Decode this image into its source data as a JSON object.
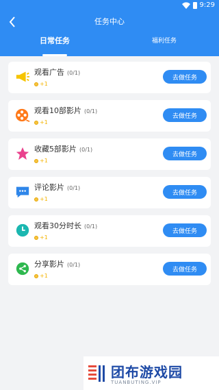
{
  "status": {
    "time": "9:29"
  },
  "header": {
    "title": "任务中心"
  },
  "tabs": [
    {
      "label": "日常任务",
      "active": true
    },
    {
      "label": "福利任务",
      "active": false
    }
  ],
  "tasks": [
    {
      "name": "观看广告",
      "progress": "(0/1)",
      "reward": "+1",
      "action": "去做任务",
      "icon": "megaphone-icon"
    },
    {
      "name": "观看10部影片",
      "progress": "(0/1)",
      "reward": "+1",
      "action": "去做任务",
      "icon": "film-reel-icon"
    },
    {
      "name": "收藏5部影片",
      "progress": "(0/1)",
      "reward": "+1",
      "action": "去做任务",
      "icon": "star-icon"
    },
    {
      "name": "评论影片",
      "progress": "(0/1)",
      "reward": "+1",
      "action": "去做任务",
      "icon": "comment-icon"
    },
    {
      "name": "观看30分时长",
      "progress": "(0/1)",
      "reward": "+1",
      "action": "去做任务",
      "icon": "clock-icon"
    },
    {
      "name": "分享影片",
      "progress": "(0/1)",
      "reward": "+1",
      "action": "去做任务",
      "icon": "share-icon"
    }
  ],
  "watermark": {
    "brand": "团布游戏园",
    "site": "TUANBUTING.VIP"
  },
  "colors": {
    "primary": "#2f8cf3",
    "coin": "#f6c343"
  }
}
